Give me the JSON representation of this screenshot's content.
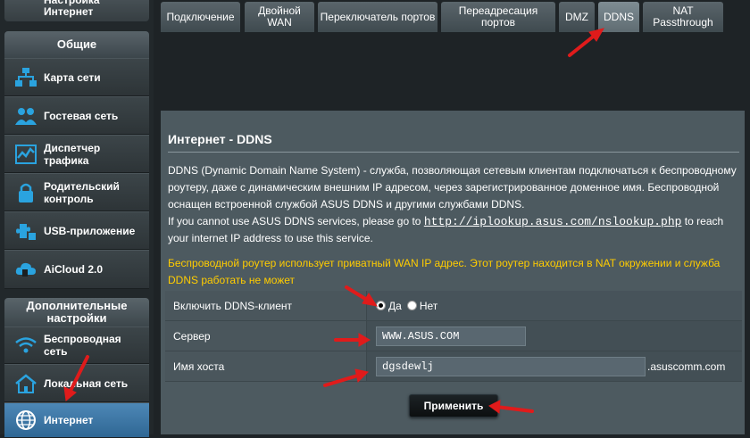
{
  "sidebar": {
    "top_item": "Настройка Интернет",
    "general_header": "Общие",
    "items": [
      {
        "label": "Карта сети",
        "icon": "network-map-icon"
      },
      {
        "label": "Гостевая сеть",
        "icon": "guest-network-icon"
      },
      {
        "label": "Диспетчер трафика",
        "icon": "traffic-manager-icon"
      },
      {
        "label": "Родительский контроль",
        "icon": "parental-control-icon"
      },
      {
        "label": "USB-приложение",
        "icon": "usb-app-icon"
      },
      {
        "label": "AiCloud 2.0",
        "icon": "aicloud-icon"
      }
    ],
    "advanced_header": "Дополнительные настройки",
    "advanced_items": [
      {
        "label": "Беспроводная сеть",
        "icon": "wireless-icon"
      },
      {
        "label": "Локальная сеть",
        "icon": "lan-home-icon"
      },
      {
        "label": "Интернет",
        "icon": "internet-globe-icon",
        "active": true
      }
    ]
  },
  "tabs": [
    {
      "label": "Подключение"
    },
    {
      "label": "Двойной WAN"
    },
    {
      "label": "Переключатель портов"
    },
    {
      "label": "Переадресация портов"
    },
    {
      "label": "DMZ"
    },
    {
      "label": "DDNS",
      "active": true
    },
    {
      "label": "NAT Passthrough"
    }
  ],
  "panel": {
    "title": "Интернет - DDNS",
    "desc_1": "DDNS (Dynamic Domain Name System) - служба, позволяющая сетевым клиентам подключаться к беспроводному роутеру, даже с динамическим внешним IP адресом, через зарегистрированное доменное имя. Беспроводной оснащен встроенной службой ASUS DDNS и другими службами DDNS.",
    "desc_2_pre": "If you cannot use ASUS DDNS services, please go to ",
    "desc_2_link": "http://iplookup.asus.com/nslookup.php",
    "desc_2_post": " to reach your internet IP address to use this service.",
    "warning": "Беспроводной роутер использует приватный WAN IP адрес. Этот роутер находится в NAT окружении и служба DDNS работать не может",
    "form": {
      "enable_label": "Включить DDNS-клиент",
      "yes_label": "Да",
      "no_label": "Нет",
      "server_label": "Сервер",
      "server_value": "WWW.ASUS.COM",
      "hostname_label": "Имя хоста",
      "hostname_value": "dgsdewlj",
      "hostname_suffix": ".asuscomm.com"
    },
    "apply_label": "Применить"
  },
  "colors": {
    "background": "#1e2326",
    "panel": "#4d5a60",
    "warning": "#ffcc00",
    "annotation_arrow": "#e01b1b",
    "active_sidebar": "#3d7aab"
  }
}
